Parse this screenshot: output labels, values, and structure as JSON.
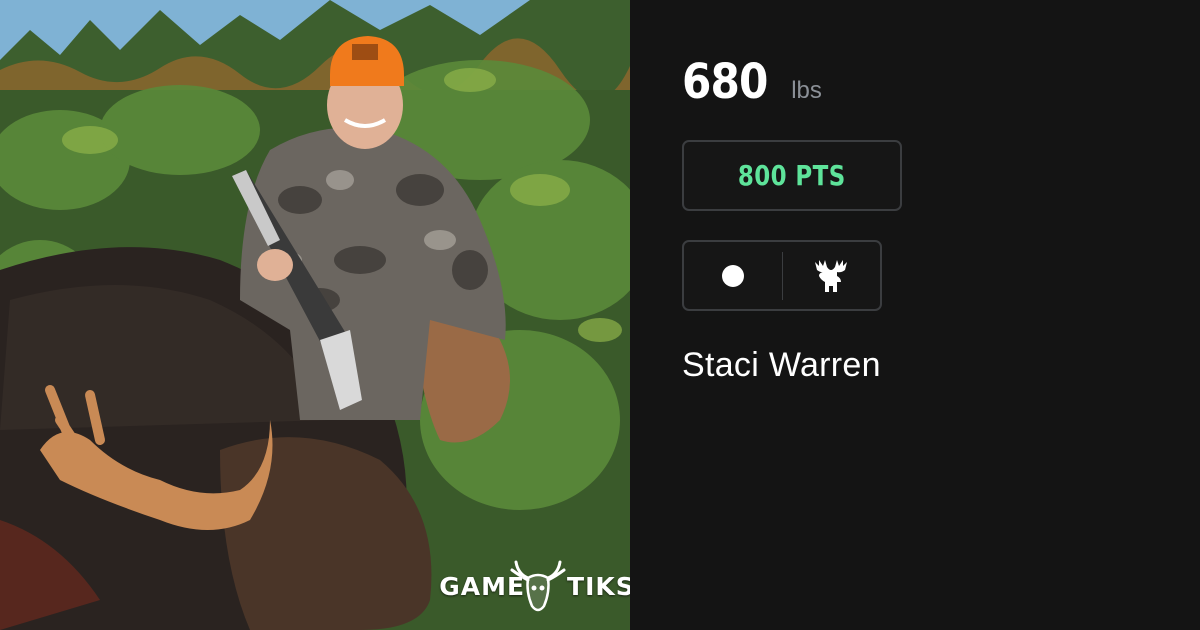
{
  "photo": {
    "subject": "moose-hunt-photo",
    "watermark": {
      "left": "GAME",
      "right": "TIKS",
      "icon": "deer-skull-icon"
    }
  },
  "stats": {
    "weight_value": "680",
    "weight_unit": "lbs",
    "points_label": "800 PTS",
    "points_color": "#5ee39a"
  },
  "icons": {
    "weapon_icon": "dot-icon",
    "species_icon": "moose-icon"
  },
  "hunter": {
    "name": "Staci Warren"
  },
  "colors": {
    "panel_bg": "#141414",
    "border": "#3b3d40",
    "muted_text": "#8b9097",
    "accent_green": "#5ee39a"
  }
}
